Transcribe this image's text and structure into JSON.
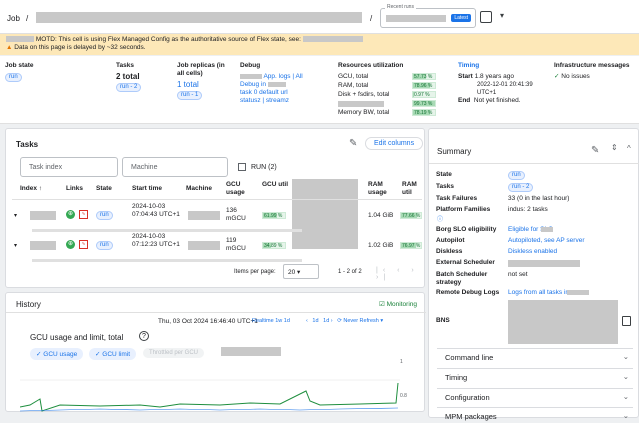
{
  "header": {
    "crumb_root": "Job",
    "crumb_sep": "/",
    "recent_runs_label": "Recent runs",
    "latest_badge": "Latest"
  },
  "motd": {
    "text": "MOTD: This cell is using Flex Managed Config as the authoritative source of Flex state, see:",
    "delay": "Data on this page is delayed by ~32 seconds."
  },
  "info": {
    "job_state": {
      "title": "Job state",
      "chip": "run"
    },
    "tasks": {
      "title": "Tasks",
      "total": "2 total",
      "chip": "run - 2"
    },
    "replicas": {
      "title": "Job replicas (in all cells)",
      "total": "1 total",
      "chip": "run - 1"
    },
    "debug": {
      "title": "Debug",
      "line1": "App. logs | All",
      "line2": "Debug in",
      "line3": "task 0 default url",
      "line4": "statusz | streamz"
    },
    "resources": {
      "title": "Resources utilization",
      "rows": [
        {
          "label": "GCU, total",
          "value": "57.73 %",
          "pct": 57.73
        },
        {
          "label": "RAM, total",
          "value": "78.96 %",
          "pct": 78.96
        },
        {
          "label": "Disk + fsdirs, total",
          "value": "0.97 %",
          "pct": 0.97
        },
        {
          "label": "",
          "value": "99.73 %",
          "pct": 99.73
        },
        {
          "label": "Memory BW, total",
          "value": "78.19 %",
          "pct": 78.19
        }
      ]
    },
    "timing": {
      "title": "Timing",
      "start_label": "Start",
      "start_value": "1.8 years ago",
      "start_ts": "2022-12-01 20:41:39 UTC+1",
      "end_label": "End",
      "end_value": "Not yet finished."
    },
    "infra": {
      "title": "Infrastructure messages",
      "status": "No issues"
    }
  },
  "tasks_card": {
    "title": "Tasks",
    "edit_columns": "Edit columns",
    "task_index_placeholder": "Task index",
    "machine_placeholder": "Machine",
    "run_filter": "RUN (2)",
    "columns": [
      "Index ↑",
      "Links",
      "State",
      "Start time",
      "Machine",
      "GCU usage",
      "GCU util",
      "RAM usage",
      "RAM util"
    ],
    "rows": [
      {
        "state": "run",
        "start": "2024-10-03 07:04:43 UTC+1",
        "gcu": "136 mGCU",
        "gcu_util": "61.99 %",
        "gcu_pct": 61.99,
        "ram": "1.04 GiB",
        "ram_util": "77.66 %",
        "ram_pct": 77.66
      },
      {
        "state": "run",
        "start": "2024-10-03 07:12:23 UTC+1",
        "gcu": "119 mGCU",
        "gcu_util": "34.89 %",
        "gcu_pct": 34.89,
        "ram": "1.02 GiB",
        "ram_util": "76.97 %",
        "ram_pct": 76.97
      }
    ],
    "items_per_page_label": "Items per page:",
    "items_per_page": "20",
    "range": "1 - 2 of 2"
  },
  "history": {
    "title": "History",
    "monitoring": "Monitoring",
    "datetime": "Thu, 03 Oct 2024 16:46:40 UTC+1",
    "realtime": "Realtime 1w 1d",
    "btn_1d": "1d",
    "btn_1d2": "1d",
    "never_refresh": "Never Refresh",
    "chart_title": "GCU usage and limit, total",
    "legend_usage": "GCU usage",
    "legend_limit": "GCU limit",
    "legend_disabled": "Throttled per GCU",
    "ytick_top": "1",
    "ytick_mid": "0.8"
  },
  "summary": {
    "title": "Summary",
    "rows": [
      {
        "k": "State",
        "v": "run",
        "chip": true
      },
      {
        "k": "Tasks",
        "v": "run - 2",
        "chip": true
      },
      {
        "k": "Task Failures",
        "v": "33 (0 in the last hour)"
      },
      {
        "k": "Platform Families",
        "v": "indus: 2 tasks"
      },
      {
        "k": "Borg SLO eligibility",
        "v": "Eligible for SLO",
        "link": true
      },
      {
        "k": "Autopilot",
        "v": "Autopiloted, see AP server",
        "link": true
      },
      {
        "k": "Diskless",
        "v": "Diskless enabled",
        "link": true
      },
      {
        "k": "External Scheduler",
        "v": ""
      },
      {
        "k": "Batch Scheduler strategy",
        "v": "not set"
      },
      {
        "k": "Remote Debug Logs",
        "v": "Logs from all tasks in",
        "link": true
      },
      {
        "k": "BNS",
        "v": ""
      }
    ],
    "sections": [
      "Command line",
      "Timing",
      "Configuration",
      "MPM packages"
    ]
  }
}
